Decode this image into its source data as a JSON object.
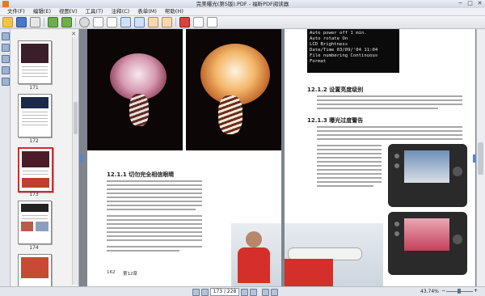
{
  "window": {
    "title": "完美曝光(第5版).PDF - 福昕PDF阅读器",
    "controls": [
      "─",
      "□",
      "✕"
    ]
  },
  "menu": [
    "文件(F)",
    "编辑(E)",
    "视图(V)",
    "工具(T)",
    "注释(C)",
    "表单(M)",
    "帮助(H)"
  ],
  "toolbar_icons": [
    "folder-icon",
    "save-icon",
    "print-icon",
    "sep",
    "back-icon",
    "forward-icon",
    "sep",
    "find-icon",
    "page-icon",
    "zoom-icon",
    "hand-icon",
    "sep",
    "red-icon"
  ],
  "thumbnails": [
    {
      "label": "171",
      "selected": false
    },
    {
      "label": "172",
      "selected": false
    },
    {
      "label": "173",
      "selected": true
    },
    {
      "label": "174",
      "selected": false
    },
    {
      "label": "",
      "selected": false
    }
  ],
  "left_page": {
    "section_heading": "12.1.1  切勿完全相信眼睛",
    "footer_left": "162",
    "footer_right": "第12章"
  },
  "right_page": {
    "lcd_lines": [
      "Auto power off 1 min.",
      "Auto rotate    On",
      "LCD Brightness",
      "Date/Time  03/09/'04 11:04",
      "File numbering  Continuous",
      "Format"
    ],
    "section1_heading": "12.1.2  设置亮度级别",
    "section2_heading": "12.1.3  曝光过度警告"
  },
  "status": {
    "page_indicator": "173 / 228",
    "zoom": "43.74%"
  }
}
